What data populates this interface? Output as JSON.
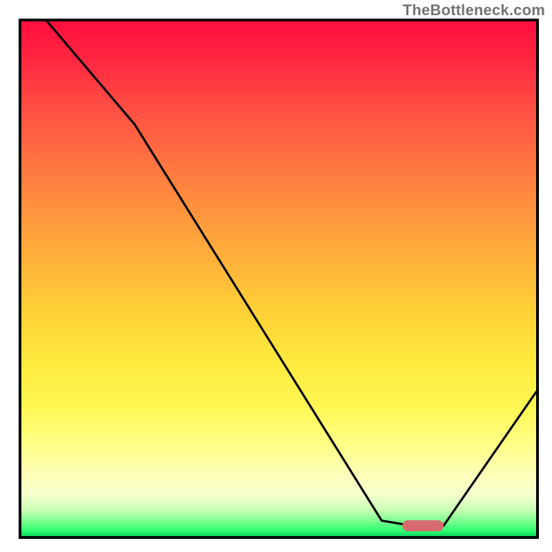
{
  "attribution": "TheBottleneck.com",
  "chart_data": {
    "type": "line",
    "title": "",
    "xlabel": "",
    "ylabel": "",
    "axis_ticks": "none",
    "xlim": [
      0,
      100
    ],
    "ylim": [
      0,
      100
    ],
    "legend": false,
    "grid": false,
    "background_gradient": {
      "direction": "vertical",
      "stops": [
        {
          "pos": 0,
          "color": "#ff0e3d"
        },
        {
          "pos": 33,
          "color": "#ff873f"
        },
        {
          "pos": 58,
          "color": "#fed536"
        },
        {
          "pos": 82,
          "color": "#ffff86"
        },
        {
          "pos": 100,
          "color": "#0dd462"
        }
      ]
    },
    "series": [
      {
        "name": "bottleneck-curve",
        "x": [
          5,
          22,
          70,
          76,
          82,
          100
        ],
        "values": [
          100,
          80,
          3,
          2,
          2,
          28
        ]
      }
    ],
    "marker": {
      "name": "optimal-range",
      "x_start": 74,
      "x_end": 82,
      "y": 2,
      "color": "#d86b70"
    }
  }
}
